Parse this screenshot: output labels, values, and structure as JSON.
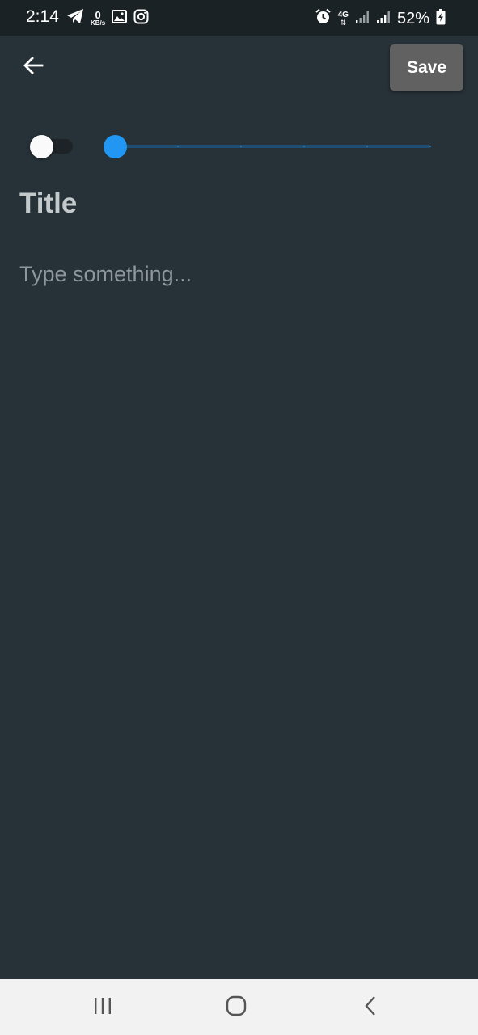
{
  "status_bar": {
    "time": "2:14",
    "net_speed_value": "0",
    "net_speed_unit": "KB/s",
    "network_type": "4G",
    "network_arrows": "⇅",
    "battery_percent": "52%",
    "icons_left": [
      "telegram-icon",
      "image-icon",
      "instagram-icon"
    ],
    "icons_right": [
      "alarm-icon",
      "signal-icon",
      "signal-icon",
      "battery-charging-icon"
    ]
  },
  "app_bar": {
    "back_icon": "arrow-back-icon",
    "save_label": "Save"
  },
  "controls": {
    "toggle_on": false,
    "slider_value_fraction": 0.0,
    "slider_ticks": 5
  },
  "editor": {
    "title_placeholder": "Title",
    "body_placeholder": "Type something..."
  },
  "nav_bar": {
    "buttons": [
      "recent-apps-icon",
      "home-icon",
      "back-icon"
    ]
  },
  "colors": {
    "background": "#263238",
    "status_bar": "#1b2226",
    "accent": "#2196f3",
    "save_button": "#616161",
    "nav_bar": "#f2f2f2"
  }
}
